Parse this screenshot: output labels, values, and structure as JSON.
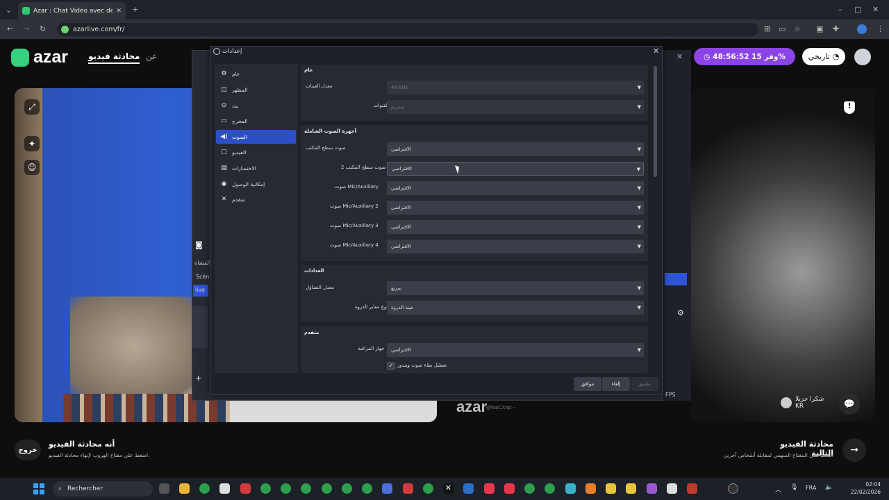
{
  "browser": {
    "tab_title": "Azar : Chat Vidéo avec de i",
    "url": "azarlive.com/fr/"
  },
  "site": {
    "logo": "azar",
    "nav_video_chat": "محادثة فيديو",
    "nav_about": "عن",
    "promo": "48:56:52 وفر 15%",
    "history": "تاريخي",
    "remote_logo": "azar",
    "remote_id": "@haiCXIqt -",
    "remote_user": "شكرا جزيلا",
    "remote_country": "KR",
    "exit_label": "خروج",
    "end_title": "أنه محادثة الفيديو",
    "end_sub": "اضغط على مفتاح الهروب لإنهاء محادثة الفيديو.",
    "next_title": "محادثة الفيديو التالية",
    "next_sub": "اضغط على المفتاح السهمي لمقابلة أشخاص آخرين"
  },
  "obs_back": {
    "scene_header": "المشاه",
    "scene_item": "Scèn",
    "source_item": "live",
    "fps": "FPS"
  },
  "settings": {
    "title": "إعدادات",
    "sidebar": [
      {
        "label": "عام",
        "icon": "gear-icon"
      },
      {
        "label": "المظهر",
        "icon": "appearance-icon"
      },
      {
        "label": "بث",
        "icon": "broadcast-icon"
      },
      {
        "label": "المخرج",
        "icon": "output-icon"
      },
      {
        "label": "الصوت",
        "icon": "speaker-icon"
      },
      {
        "label": "الفيديو",
        "icon": "monitor-icon"
      },
      {
        "label": "الاختصارات",
        "icon": "keyboard-icon"
      },
      {
        "label": "إمكانية الوصول",
        "icon": "accessibility-icon"
      },
      {
        "label": "متقدم",
        "icon": "wrench-icon"
      }
    ],
    "general": {
      "header": "عام",
      "sample_rate_label": "معدل العينات",
      "sample_rate_value": "48 kHz",
      "channels_label": "القنوات",
      "channels_value": "ستيريو"
    },
    "global_audio": {
      "header": "أجهزة الصوت الشاملة",
      "rows": [
        {
          "label": "صوت سطح المكتب",
          "value": "الافتراضي"
        },
        {
          "label": "صوت سطح المكتب 2",
          "value": "الافتراضي"
        },
        {
          "label": "صوت Mic/Auxiliary",
          "value": "الافتراضي"
        },
        {
          "label": "صوت Mic/Auxiliary 2",
          "value": "الافتراضي"
        },
        {
          "label": "صوت Mic/Auxiliary 3",
          "value": "الافتراضي"
        },
        {
          "label": "صوت Mic/Auxiliary 4",
          "value": "الافتراضي"
        }
      ]
    },
    "meters": {
      "header": "العدادات",
      "decay_label": "معدل التضاؤل",
      "decay_value": "سريع",
      "peak_label": "نوع معاير الذروة",
      "peak_value": "عينة الذروة"
    },
    "advanced": {
      "header": "متقدم",
      "monitor_label": "جهاز المراقبة",
      "monitor_value": "الافتراضي",
      "ducking_label": "تعطيل بطء صوت ويندوز",
      "ducking_checked": true
    },
    "buttons": {
      "ok": "موافق",
      "cancel": "إلغاء",
      "apply": "تطبيق"
    }
  },
  "taskbar": {
    "search_placeholder": "Rechercher",
    "lang": "FRA",
    "time": "02:04",
    "date": "22/02/2026"
  }
}
